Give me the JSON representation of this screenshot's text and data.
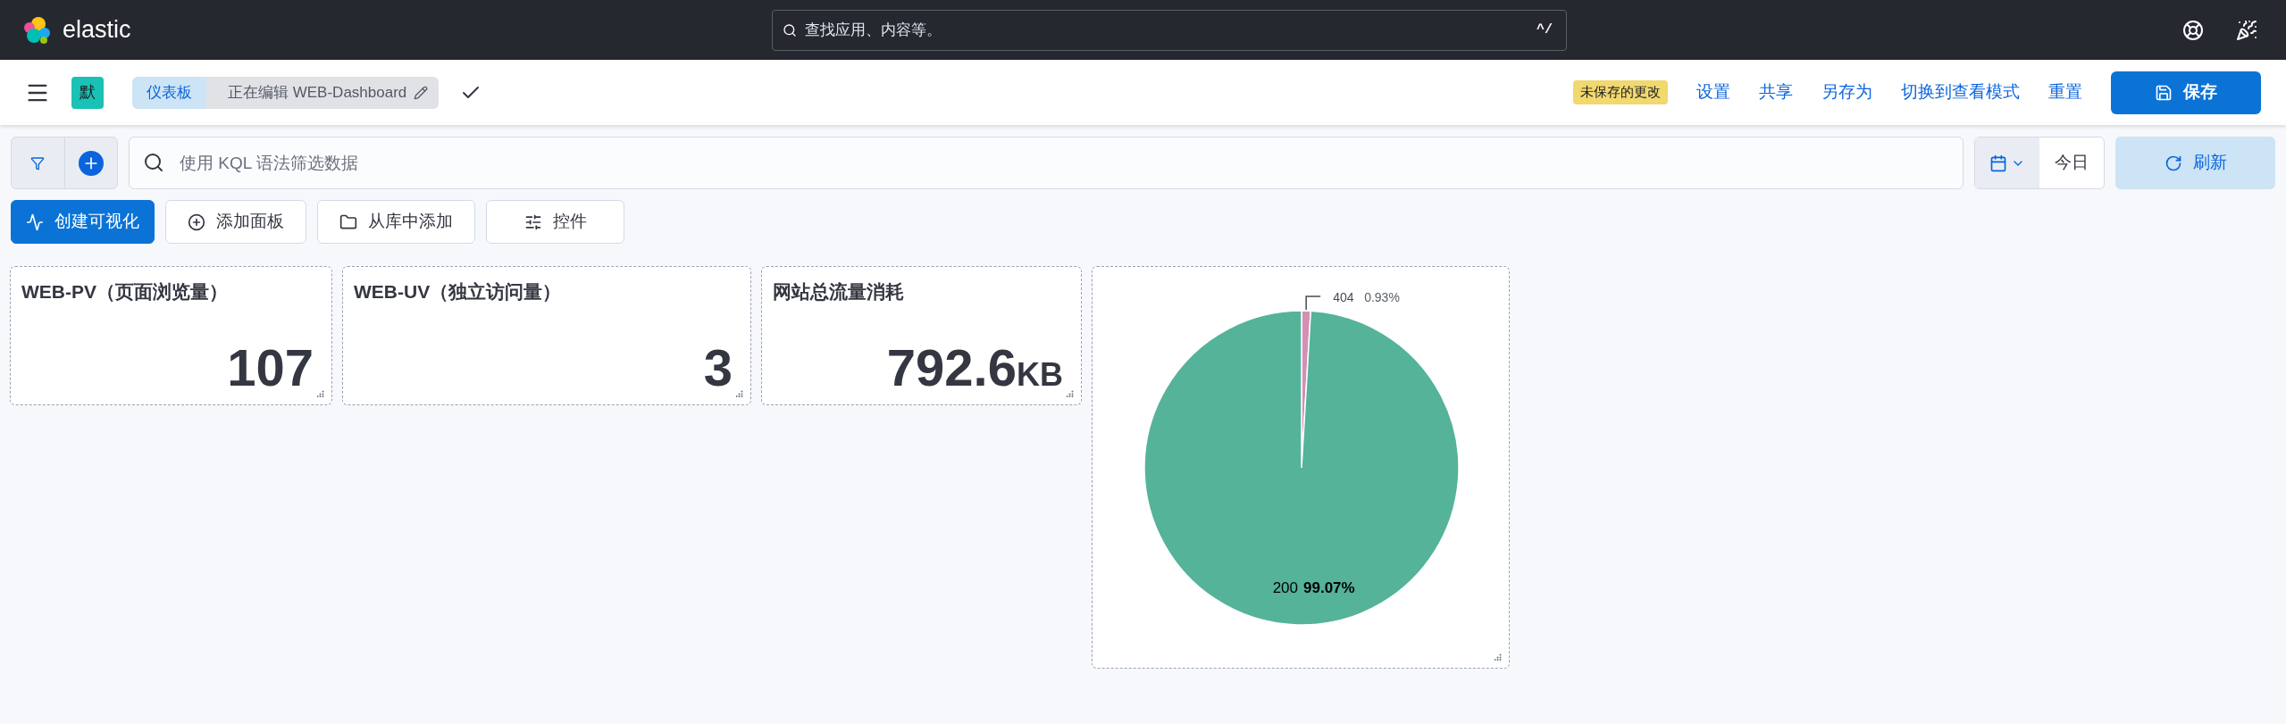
{
  "header": {
    "logo_text": "elastic",
    "search": {
      "placeholder": "查找应用、内容等。",
      "shortcut": "^/"
    }
  },
  "app_bar": {
    "space_badge": "默",
    "breadcrumbs": [
      {
        "label": "仪表板",
        "selected": false
      },
      {
        "label": "正在编辑 WEB-Dashboard",
        "selected": true
      }
    ],
    "unsaved_badge": "未保存的更改",
    "links": [
      "设置",
      "共享",
      "另存为",
      "切换到查看模式",
      "重置"
    ],
    "save_button": "保存"
  },
  "query_bar": {
    "placeholder": "使用 KQL 语法筛选数据",
    "date": "今日",
    "refresh_button": "刷新"
  },
  "toolbar": [
    {
      "label": "创建可视化",
      "kind": "primary"
    },
    {
      "label": "添加面板",
      "kind": "add"
    },
    {
      "label": "从库中添加",
      "kind": "library"
    },
    {
      "label": "控件",
      "kind": "controls"
    }
  ],
  "panels": [
    {
      "title": "WEB-PV（页面浏览量）",
      "value": "107"
    },
    {
      "title": "WEB-UV（独立访问量）",
      "value": "3"
    },
    {
      "title": "网站总流量消耗",
      "value": "792.6",
      "unit": "KB"
    }
  ],
  "pie_panel": {
    "chart_data": {
      "type": "pie",
      "categories": [
        "200",
        "404"
      ],
      "values": [
        99.07,
        0.93
      ],
      "value_labels": [
        "99.07%",
        "0.93%"
      ]
    }
  }
}
